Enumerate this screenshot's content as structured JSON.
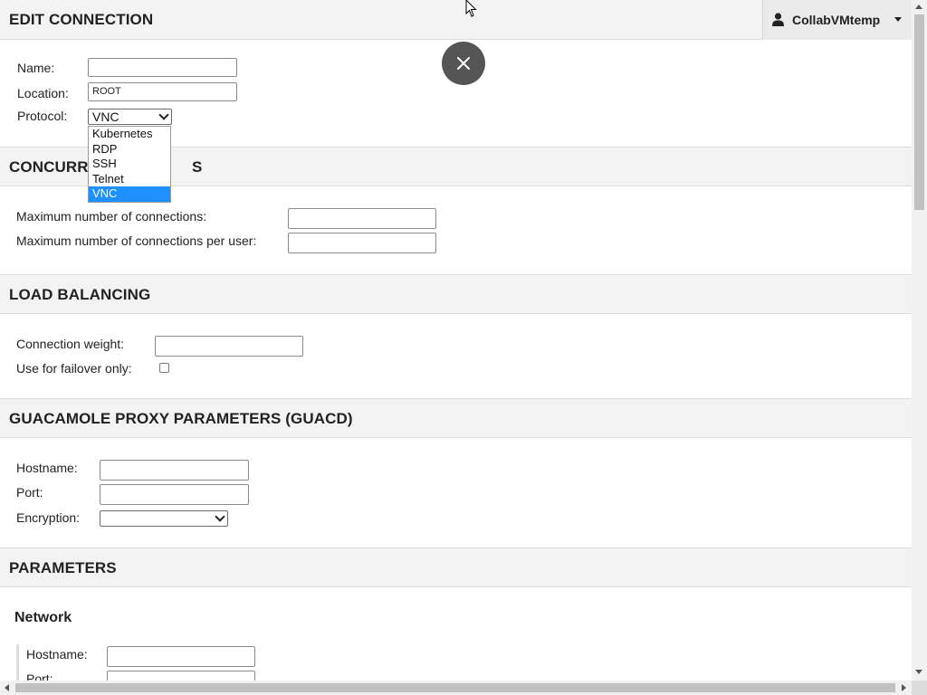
{
  "header": {
    "title": "EDIT CONNECTION",
    "user": "CollabVMtemp"
  },
  "basic": {
    "name_label": "Name:",
    "name_value": "",
    "location_label": "Location:",
    "location_value": "ROOT",
    "protocol_label": "Protocol:",
    "protocol_value": "VNC",
    "protocol_options": [
      "Kubernetes",
      "RDP",
      "SSH",
      "Telnet",
      "VNC"
    ]
  },
  "concurrency": {
    "title": "CONCURRENCY LIMITS",
    "title_visible_start": "CONCURRE",
    "title_visible_end": "S",
    "max_connections_label": "Maximum number of connections:",
    "max_per_user_label": "Maximum number of connections per user:"
  },
  "load_balancing": {
    "title": "LOAD BALANCING",
    "weight_label": "Connection weight:",
    "failover_label": "Use for failover only:",
    "failover_checked": false
  },
  "guacd": {
    "title": "GUACAMOLE PROXY PARAMETERS (GUACD)",
    "hostname_label": "Hostname:",
    "port_label": "Port:",
    "encryption_label": "Encryption:",
    "encryption_value": ""
  },
  "parameters": {
    "title": "PARAMETERS",
    "network_title": "Network",
    "hostname_label": "Hostname:",
    "port_label": "Port:"
  },
  "colors": {
    "header_bg": "#f3f3f3",
    "selected_option": "#1e90ff",
    "close_button": "#555555"
  }
}
